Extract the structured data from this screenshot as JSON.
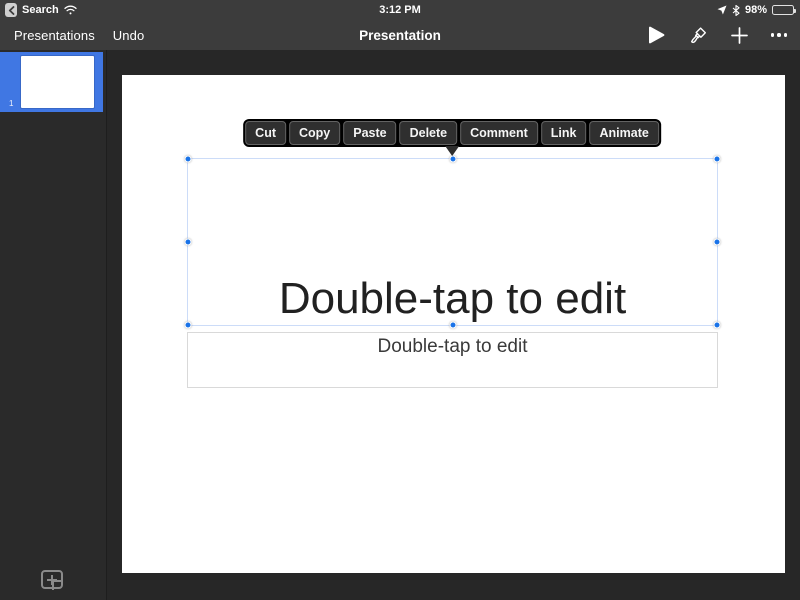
{
  "status_bar": {
    "back_app_label": "Search",
    "time": "3:12 PM",
    "battery_percent": "98%"
  },
  "toolbar": {
    "presentations_label": "Presentations",
    "undo_label": "Undo",
    "document_title": "Presentation"
  },
  "filmstrip": {
    "slide_number": "1"
  },
  "context_menu": {
    "items": [
      "Cut",
      "Copy",
      "Paste",
      "Delete",
      "Comment",
      "Link",
      "Animate"
    ]
  },
  "slide": {
    "title_placeholder": "Double-tap to edit",
    "subtitle_placeholder": "Double-tap to edit"
  },
  "icons": {
    "back": "back-chevron-icon",
    "wifi": "wifi-icon",
    "location": "location-arrow-icon",
    "bluetooth": "bluetooth-icon",
    "battery": "battery-icon",
    "present": "play-icon",
    "format": "format-paint-icon",
    "insert": "plus-icon",
    "more": "ellipsis-icon",
    "add_slide": "add-slide-plus-icon"
  },
  "colors": {
    "chrome_bg": "#3c3c3c",
    "canvas_bg": "#272727",
    "sidebar_bg": "#2a2a2a",
    "selection_blue": "#4077e3",
    "handle_blue": "#1a73e8",
    "selection_border": "#ccdcf8",
    "menu_bg": "#000000",
    "menu_button_bg": "#2f2f2f"
  }
}
